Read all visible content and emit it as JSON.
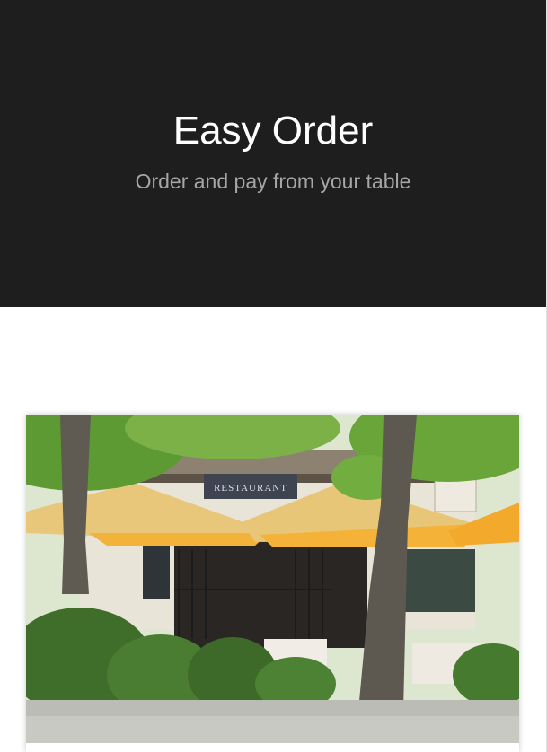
{
  "hero": {
    "title": "Easy Order",
    "subtitle": "Order and pay from your table"
  },
  "card": {
    "image_alt": "Restaurant terrace with yellow umbrellas",
    "sign_text": "RESTAURANT",
    "colors": {
      "umbrella": "#f3b93f",
      "foliage": "#4f8a2a",
      "sky": "#dfe9d6"
    }
  },
  "colors": {
    "hero_bg": "#1e1e1e",
    "title": "#ffffff",
    "subtitle": "#a6a6a6"
  }
}
